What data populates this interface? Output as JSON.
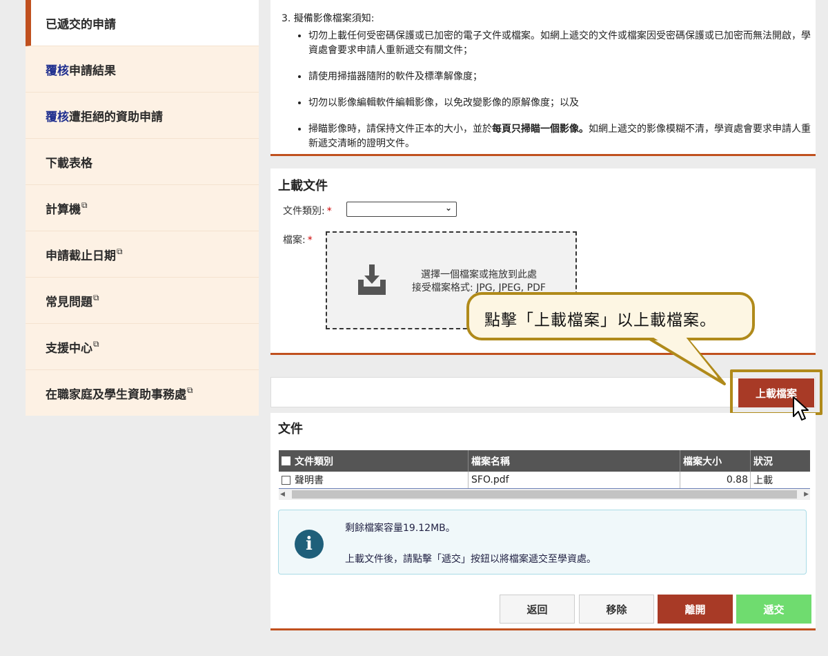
{
  "sidebar": {
    "items": [
      {
        "label": "已遞交的申請"
      },
      {
        "prefix": "覆核",
        "label": "申請結果"
      },
      {
        "prefix": "覆核",
        "label": "遭拒絕的資助申請"
      },
      {
        "label": "下載表格"
      },
      {
        "label": "計算機",
        "external": "⧉"
      },
      {
        "label": "申請截止日期",
        "external": "⧉"
      },
      {
        "label": "常見問題",
        "external": "⧉"
      },
      {
        "label": "支援中心",
        "external": "⧉"
      },
      {
        "label": "在職家庭及學生資助事務處",
        "external": "⧉"
      }
    ]
  },
  "notes": {
    "heading": "3. 擬備影像檔案須知:",
    "items": [
      {
        "text": "切勿上載任何受密碼保護或已加密的電子文件或檔案。如網上遞交的文件或檔案因受密碼保護或已加密而無法開啟，學資處會要求申請人重新遞交有關文件；"
      },
      {
        "text": "請使用掃描器隨附的軟件及標準解像度；"
      },
      {
        "text": "切勿以影像編輯軟件編輯影像，以免改變影像的原解像度；以及"
      },
      {
        "pre": "掃瞄影像時，請保持文件正本的大小，並於",
        "bold": "每頁只掃瞄一個影像。",
        "post": "如網上遞交的影像模糊不清，學資處會要求申請人重新遞交清晰的證明文件。"
      }
    ]
  },
  "upload": {
    "title": "上載文件",
    "doc_type_label": "文件類別:",
    "file_label": "檔案:",
    "required_mark": "*",
    "select_value": "",
    "drop_line1": "選擇一個檔案或拖放到此處",
    "drop_line2": "接受檔案格式: JPG, JPEG, PDF",
    "icon": "tray-download-icon"
  },
  "upload_button": {
    "label": "上載檔案"
  },
  "tooltip": {
    "text": "點擊「上載檔案」以上載檔案。"
  },
  "documents": {
    "title": "文件",
    "columns": [
      "文件類別",
      "檔案名稱",
      "檔案大小",
      "狀況"
    ],
    "rows": [
      {
        "type": "聲明書",
        "file": "SFO.pdf",
        "size": "0.88",
        "status": "上載"
      }
    ]
  },
  "info": {
    "line1": "剩餘檔案容量19.12MB。",
    "line2": "上載文件後，請點擊「遞交」按鈕以將檔案遞交至學資處。",
    "icon": "info-icon"
  },
  "actions": {
    "back": "返回",
    "remove": "移除",
    "leave": "離開",
    "submit": "遞交"
  },
  "colors": {
    "accent": "#c0501e",
    "primary_button": "#a83a26",
    "submit_button": "#6fdc6f",
    "highlight": "#b08a1a"
  }
}
